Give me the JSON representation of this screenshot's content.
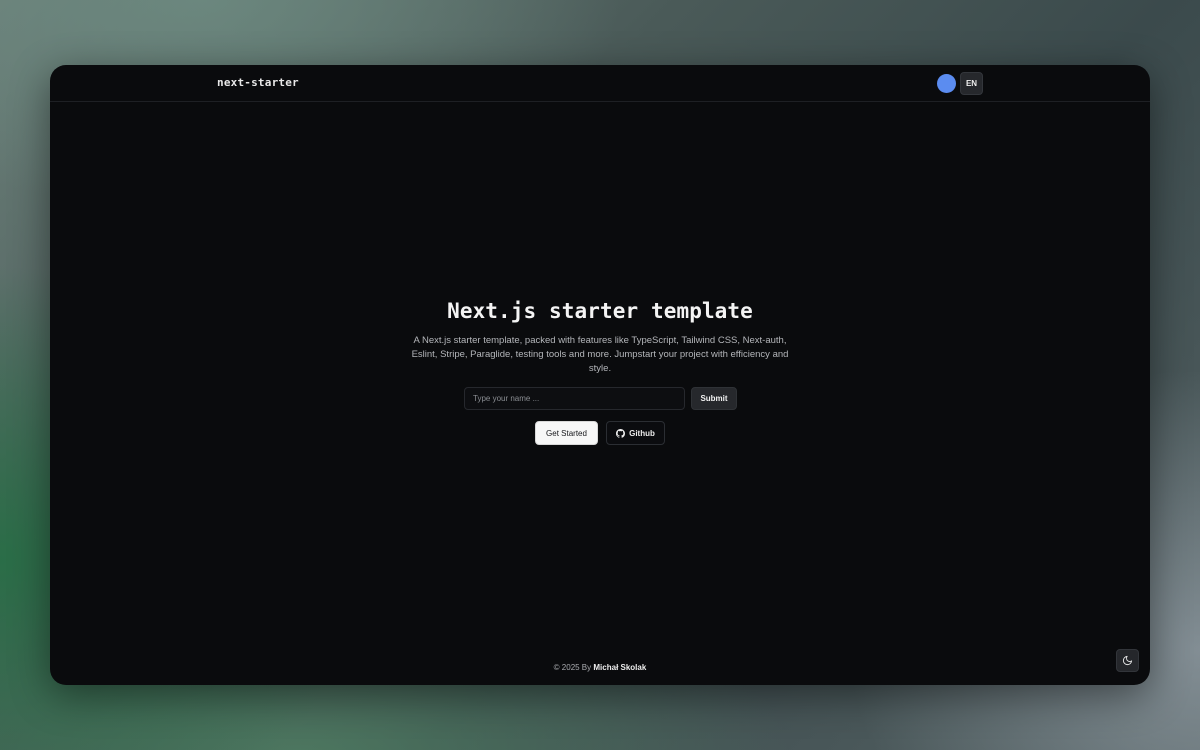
{
  "header": {
    "brand": "next-starter",
    "language_label": "EN"
  },
  "hero": {
    "title": "Next.js starter template",
    "description": "A Next.js starter template, packed with features like TypeScript, Tailwind CSS, Next-auth, Eslint, Stripe, Paraglide, testing tools and more. Jumpstart your project with efficiency and style."
  },
  "form": {
    "name_placeholder": "Type your name ...",
    "name_value": "",
    "submit_label": "Submit"
  },
  "actions": {
    "get_started_label": "Get Started",
    "github_label": "Github"
  },
  "footer": {
    "copyright_prefix": "© 2025 By",
    "author": "Michał Skolak"
  },
  "icons": {
    "github": "github-icon",
    "theme_toggle": "moon-icon"
  },
  "colors": {
    "avatar": "#5b8cf0",
    "window_background": "#0a0b0d"
  }
}
